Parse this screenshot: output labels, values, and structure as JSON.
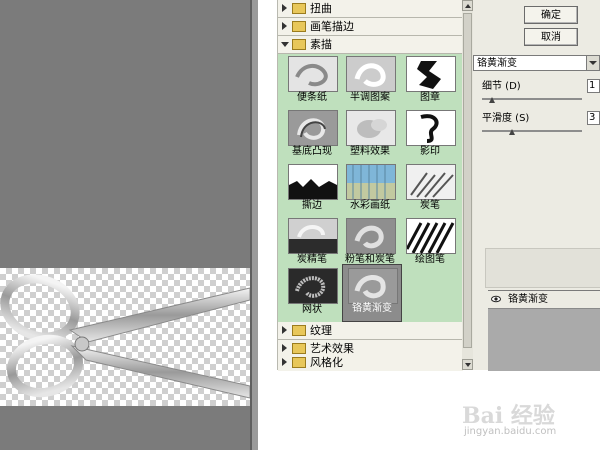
{
  "dialog": {
    "ok_label": "确定",
    "cancel_label": "取消"
  },
  "categories_top": [
    {
      "label": "扭曲",
      "expanded": false
    },
    {
      "label": "画笔描边",
      "expanded": false
    },
    {
      "label": "素描",
      "expanded": true
    }
  ],
  "sketch_filters": [
    {
      "label": "便条纸"
    },
    {
      "label": "半调图案"
    },
    {
      "label": "图章"
    },
    {
      "label": "基底凸现"
    },
    {
      "label": "塑料效果"
    },
    {
      "label": "影印"
    },
    {
      "label": "撕边"
    },
    {
      "label": "水彩画纸"
    },
    {
      "label": "炭笔"
    },
    {
      "label": "炭精笔"
    },
    {
      "label": "粉笔和炭笔"
    },
    {
      "label": "绘图笔"
    },
    {
      "label": "网状"
    },
    {
      "label": "铬黄渐变",
      "selected": true
    }
  ],
  "categories_bottom": [
    {
      "label": "纹理",
      "expanded": false
    },
    {
      "label": "艺术效果",
      "expanded": false
    },
    {
      "label": "风格化",
      "expanded": false
    }
  ],
  "settings": {
    "selected_filter": "铬黄渐变",
    "detail_label": "细节 (D)",
    "detail_value": "1",
    "detail_level": 0.1,
    "smoothness_label": "平滑度 (S)",
    "smoothness_value": "3",
    "smoothness_level": 0.3
  },
  "effect_layer": {
    "name": "铬黄渐变"
  },
  "watermark": {
    "brand": "Bai 经验",
    "url": "jingyan.baidu.com"
  }
}
